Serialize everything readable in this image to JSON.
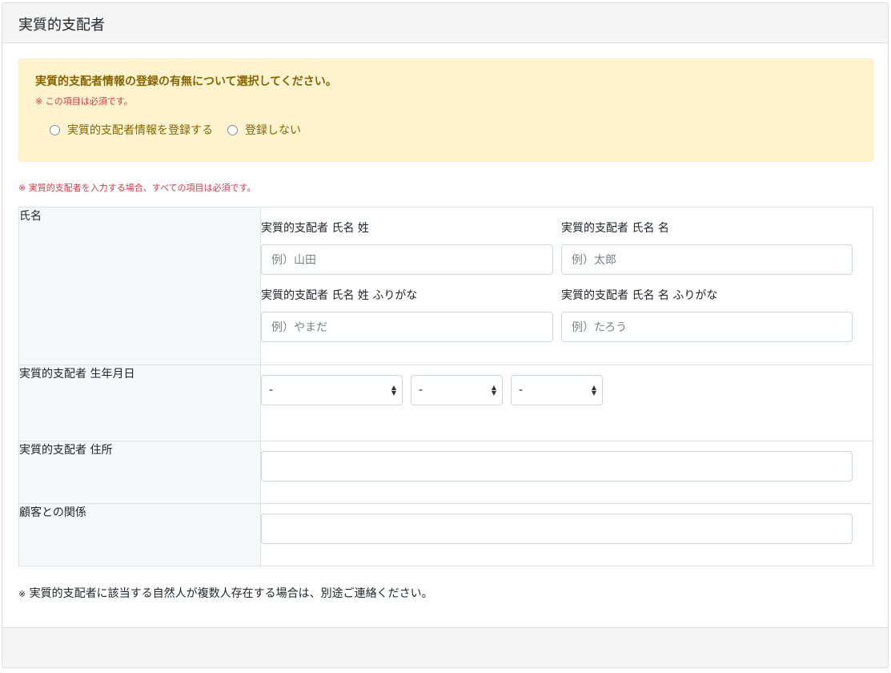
{
  "header": {
    "title": "実質的支配者"
  },
  "alert": {
    "question": "実質的支配者情報の登録の有無について選択してください。",
    "required_note": "※ この項目は必須です。",
    "options": [
      {
        "label": "実質的支配者情報を登録する",
        "selected": false
      },
      {
        "label": "登録しない",
        "selected": false
      }
    ]
  },
  "form_note": "※ 実質的支配者を入力する場合、すべての項目は必須です。",
  "rows": {
    "name": {
      "label": "氏名",
      "fields": [
        {
          "label": "実質的支配者 氏名 姓",
          "placeholder": "例）山田"
        },
        {
          "label": "実質的支配者 氏名 名",
          "placeholder": "例）太郎"
        },
        {
          "label": "実質的支配者 氏名 姓 ふりがな",
          "placeholder": "例）やまだ"
        },
        {
          "label": "実質的支配者 氏名 名 ふりがな",
          "placeholder": "例）たろう"
        }
      ]
    },
    "birthdate": {
      "label": "実質的支配者 生年月日",
      "year": "-",
      "month": "-",
      "day": "-"
    },
    "address": {
      "label": "実質的支配者 住所",
      "value": ""
    },
    "relationship": {
      "label": "顧客との関係",
      "value": ""
    }
  },
  "footer_note": {
    "mark": "※",
    "text": "実質的支配者に該当する自然人が複数人存在する場合は、別途ご連絡ください。"
  },
  "colors": {
    "alert_bg": "#fff3cd",
    "alert_text": "#856404",
    "required": "#dc3545",
    "label_bg": "#f7f8fa",
    "border": "#dee2e6"
  }
}
